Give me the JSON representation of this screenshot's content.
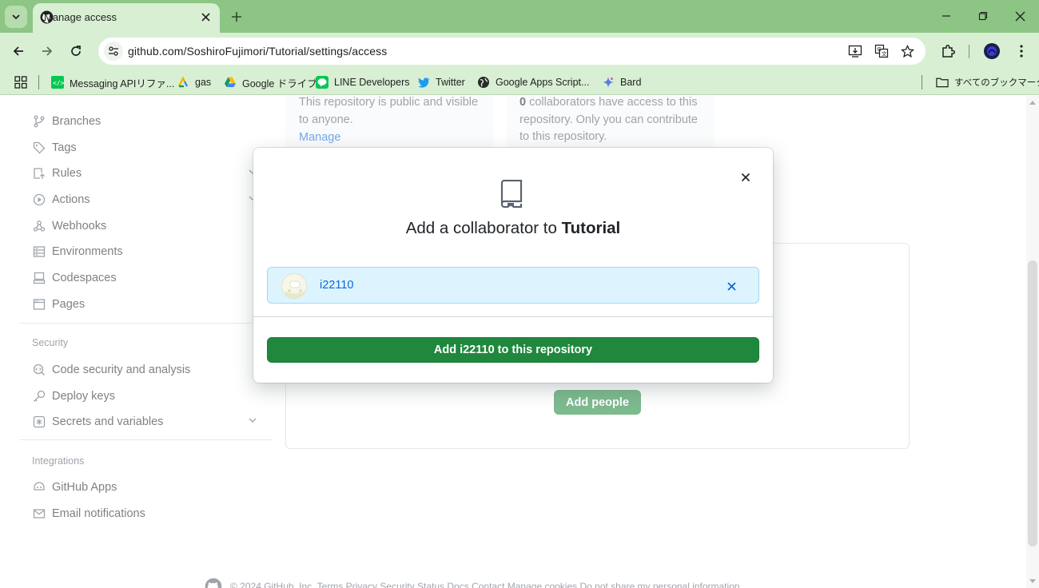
{
  "browser": {
    "tab_title": "Manage access",
    "url": "github.com/SoshiroFujimori/Tutorial/settings/access",
    "bookmarks": [
      {
        "label": "Messaging APIリファ...",
        "icon": "line-api-icon"
      },
      {
        "label": "gas",
        "icon": "gas-icon"
      },
      {
        "label": "Google ドライブ",
        "icon": "google-drive-icon"
      },
      {
        "label": "LINE Developers",
        "icon": "line-icon"
      },
      {
        "label": "Twitter",
        "icon": "twitter-icon"
      },
      {
        "label": "Google Apps Script...",
        "icon": "globe-icon"
      },
      {
        "label": "Bard",
        "icon": "bard-icon"
      }
    ],
    "all_bookmarks": "すべてのブックマーク",
    "colors": {
      "frame": "#8cc584",
      "toolbar": "#d8efd3"
    }
  },
  "sidebar": {
    "code_items": [
      {
        "label": "Branches",
        "icon": "branch-icon"
      },
      {
        "label": "Tags",
        "icon": "tag-icon"
      },
      {
        "label": "Rules",
        "icon": "rules-icon"
      },
      {
        "label": "Actions",
        "icon": "actions-icon"
      },
      {
        "label": "Webhooks",
        "icon": "webhook-icon"
      },
      {
        "label": "Environments",
        "icon": "environments-icon"
      },
      {
        "label": "Codespaces",
        "icon": "codespaces-icon"
      },
      {
        "label": "Pages",
        "icon": "pages-icon"
      }
    ],
    "security_heading": "Security",
    "security_items": [
      {
        "label": "Code security and analysis",
        "icon": "codescan-icon"
      },
      {
        "label": "Deploy keys",
        "icon": "key-icon"
      },
      {
        "label": "Secrets and variables",
        "icon": "secret-icon"
      }
    ],
    "integrations_heading": "Integrations",
    "integrations_items": [
      {
        "label": "GitHub Apps",
        "icon": "apps-icon"
      },
      {
        "label": "Email notifications",
        "icon": "mail-icon"
      }
    ]
  },
  "main": {
    "visibility_text": "This repository is public and visible to anyone.",
    "manage_link": "Manage",
    "collab_count": "0",
    "collab_text": " collaborators have access to this repository. Only you can contribute to this repository.",
    "add_people_label": "Add people",
    "footer_text": "© 2024 GitHub, Inc.   Terms   Privacy   Security   Status   Docs   Contact   Manage cookies   Do not share my personal information"
  },
  "dialog": {
    "heading_prefix": "Add a collaborator to ",
    "repo_name": "Tutorial",
    "selected_user": "i22110",
    "confirm_label": "Add i22110 to this repository",
    "accent": "#1f883d"
  }
}
